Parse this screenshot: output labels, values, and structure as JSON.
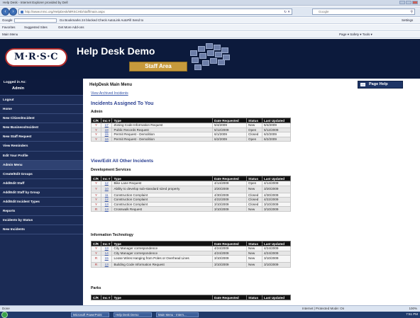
{
  "browser": {
    "title": "Help Desk - Internet Explorer provided by Dell",
    "url": "http://www.mrsc.org/HelpDesk/MRSCHD/staff/main.aspx",
    "search_placeholder": "Google",
    "google_label": "Google",
    "google_tools": "Go  Bookmarks  24 blocked  Check  AutoLink  AutoFill  Send to",
    "settings_label": "Settings",
    "favorites_label": "Favorites",
    "suggested_sites": "Suggested Sites",
    "addons": "Get More Add-ons",
    "tab_label": "Main Menu",
    "command_bar": "Page ▾  Safety ▾  Tools ▾"
  },
  "header": {
    "logo_text": "M·R·S·C",
    "site_title": "Help Desk Demo",
    "staff_area": "Staff Area"
  },
  "sidebar": {
    "logged_in_as": "Logged in As:",
    "user": "Admin",
    "items": [
      "Logout",
      "Home",
      "New Citizen/Incident",
      "New Business/Incident",
      "New Staff Request",
      "View Reminders",
      "Edit Your Profile",
      "Admin Menu",
      "Create/Edit Groups",
      "Add/Edit Staff",
      "Add/Edit Staff by Group",
      "Add/Edit Incident Types",
      "Reports",
      "Incidents by Status",
      "New Incidents"
    ]
  },
  "main": {
    "heading": "HelpDesk Main Menu",
    "archived_link": "View Archived Incidents",
    "assigned_heading": "Incidents Assigned To You",
    "page_help": "Page Help",
    "view_all_link": "View/Edit All Other Incidents",
    "columns": {
      "cr": "C/R",
      "inc": "Inc #",
      "type": "Type",
      "date": "Date Requested",
      "status": "Status",
      "updated": "Last Updated"
    },
    "admin": {
      "label": "Admin",
      "rows": [
        {
          "cr": "Y",
          "inc": "17",
          "type": "Zoning Code Information Request",
          "date": "5/4/2009",
          "status": "New",
          "updated": "5/4/2009"
        },
        {
          "cr": "Y",
          "inc": "18",
          "type": "Public Records Request",
          "date": "5/12/2009",
          "status": "Open",
          "updated": "5/12/2009"
        },
        {
          "cr": "Y",
          "inc": "15",
          "type": "Permit Request - Demolition",
          "date": "6/1/2009",
          "status": "Closed",
          "updated": "6/2/2009"
        },
        {
          "cr": "Y",
          "inc": "16",
          "type": "Permit Request - Demolition",
          "date": "6/2/2009",
          "status": "Open",
          "updated": "6/2/2009"
        }
      ]
    },
    "development": {
      "label": "Development Services",
      "rows": [
        {
          "cr": "Y",
          "inc": "12",
          "type": "Bike Lane Request",
          "date": "4/14/2009",
          "status": "Open",
          "updated": "4/14/2009"
        },
        {
          "cr": "Y",
          "inc": "10",
          "type": "Ability to develop sub-standard sized property",
          "date": "3/20/2009",
          "status": "New",
          "updated": "3/20/2009"
        },
        {
          "cr": "Y",
          "inc": "11",
          "type": "Construction Complaint",
          "date": "4/30/2009",
          "status": "Closed",
          "updated": "4/30/2009"
        },
        {
          "cr": "Y",
          "inc": "12",
          "type": "Construction Complaint",
          "date": "4/22/2009",
          "status": "Closed",
          "updated": "4/22/2009"
        },
        {
          "cr": "Y",
          "inc": "13",
          "type": "Construction Complaint",
          "date": "3/10/2009",
          "status": "Closed",
          "updated": "3/10/2009"
        },
        {
          "cr": "R",
          "inc": "13",
          "type": "Crosswalk Request",
          "date": "3/10/2009",
          "status": "New",
          "updated": "3/10/2009"
        }
      ]
    },
    "it": {
      "label": "Information Technology",
      "rows": [
        {
          "cr": "Y",
          "inc": "13",
          "type": "City Manager correspondence",
          "date": "4/24/2009",
          "status": "New",
          "updated": "4/24/2009"
        },
        {
          "cr": "Y",
          "inc": "14",
          "type": "City Manager correspondence",
          "date": "4/24/2009",
          "status": "New",
          "updated": "4/24/2009"
        },
        {
          "cr": "R",
          "inc": "15",
          "type": "Loose Wires Hanging from Poles or Overhead Lines",
          "date": "3/10/2009",
          "status": "New",
          "updated": "3/10/2009"
        },
        {
          "cr": "R",
          "inc": "13",
          "type": "Building Code Information Request",
          "date": "3/10/2009",
          "status": "New",
          "updated": "3/10/2009"
        }
      ]
    },
    "parks": {
      "label": "Parks"
    }
  },
  "status": {
    "left": "Done",
    "zone": "Internet | Protected Mode: On",
    "zoom": "100%"
  },
  "taskbar": {
    "tasks": [
      "Microsoft PowerPoint",
      "Help Desk Demo",
      "Main Menu - Intern..."
    ],
    "clock": "7:51 PM"
  }
}
